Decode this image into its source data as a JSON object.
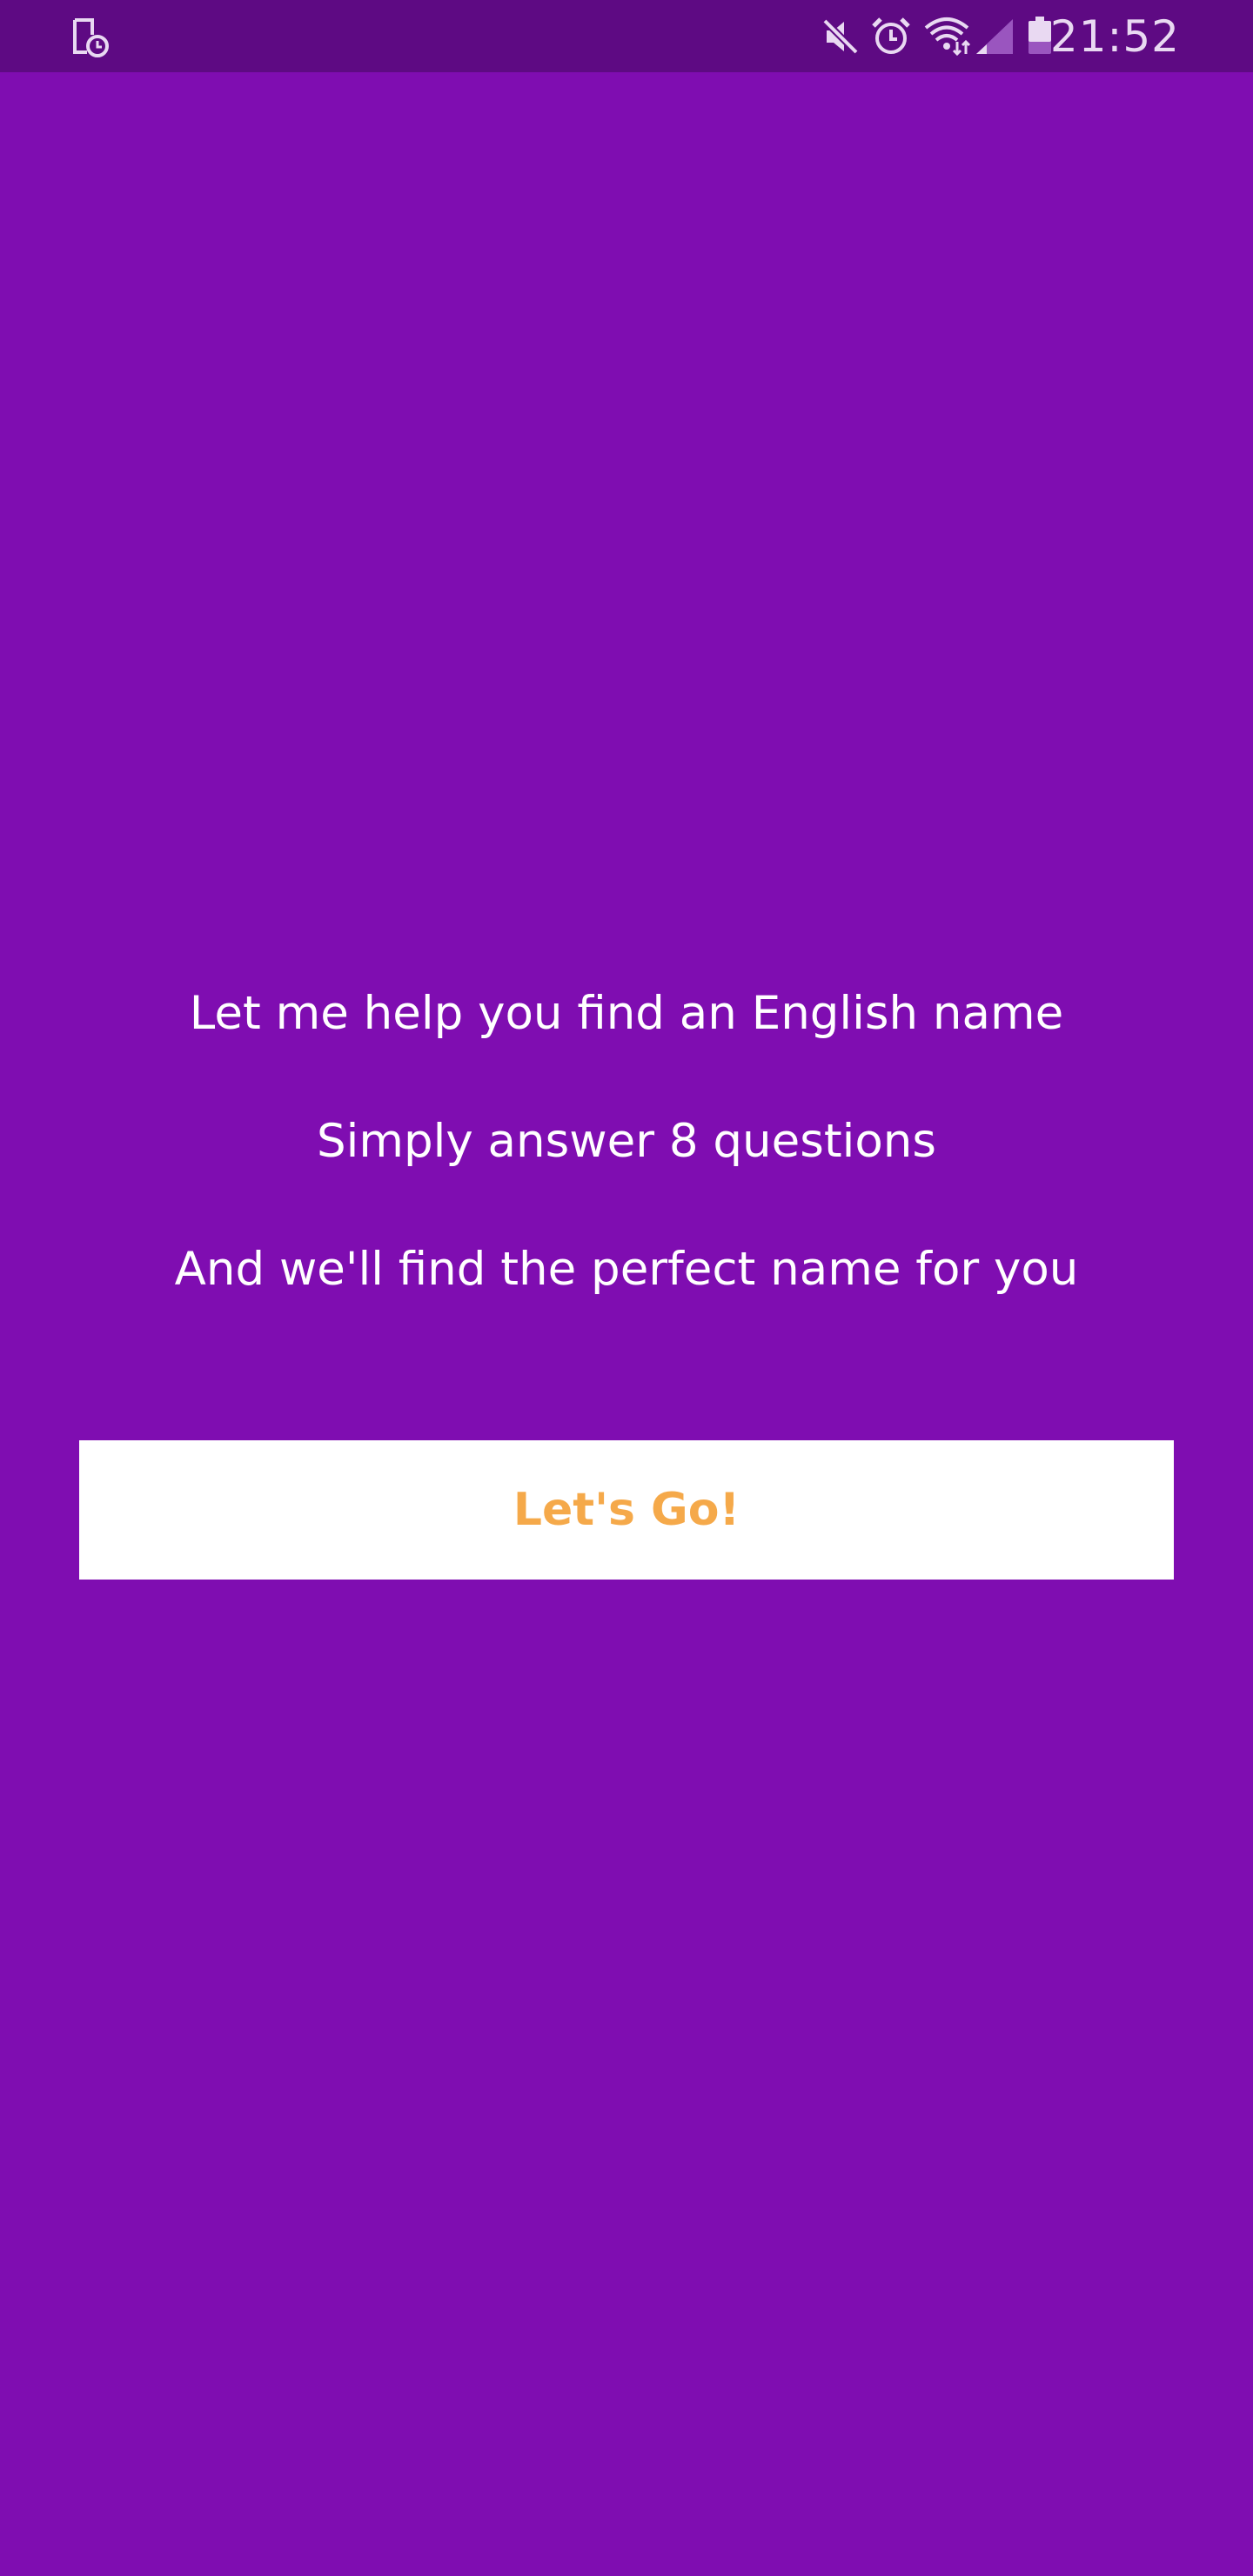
{
  "status_bar": {
    "time": "21:52",
    "icons": [
      "screen-timer-icon",
      "mute-icon",
      "alarm-icon",
      "wifi-icon",
      "signal-icon",
      "battery-icon"
    ]
  },
  "intro": {
    "line1": "Let me help you find an English name",
    "line2": "Simply answer 8 questions",
    "line3": "And we'll find the perfect name for you"
  },
  "cta": {
    "label": "Let's Go!"
  },
  "colors": {
    "background": "#7f0db1",
    "status_bar": "#5e0a83",
    "text": "#ffffff",
    "button_background": "#ffffff",
    "button_text": "#f5a94a"
  }
}
